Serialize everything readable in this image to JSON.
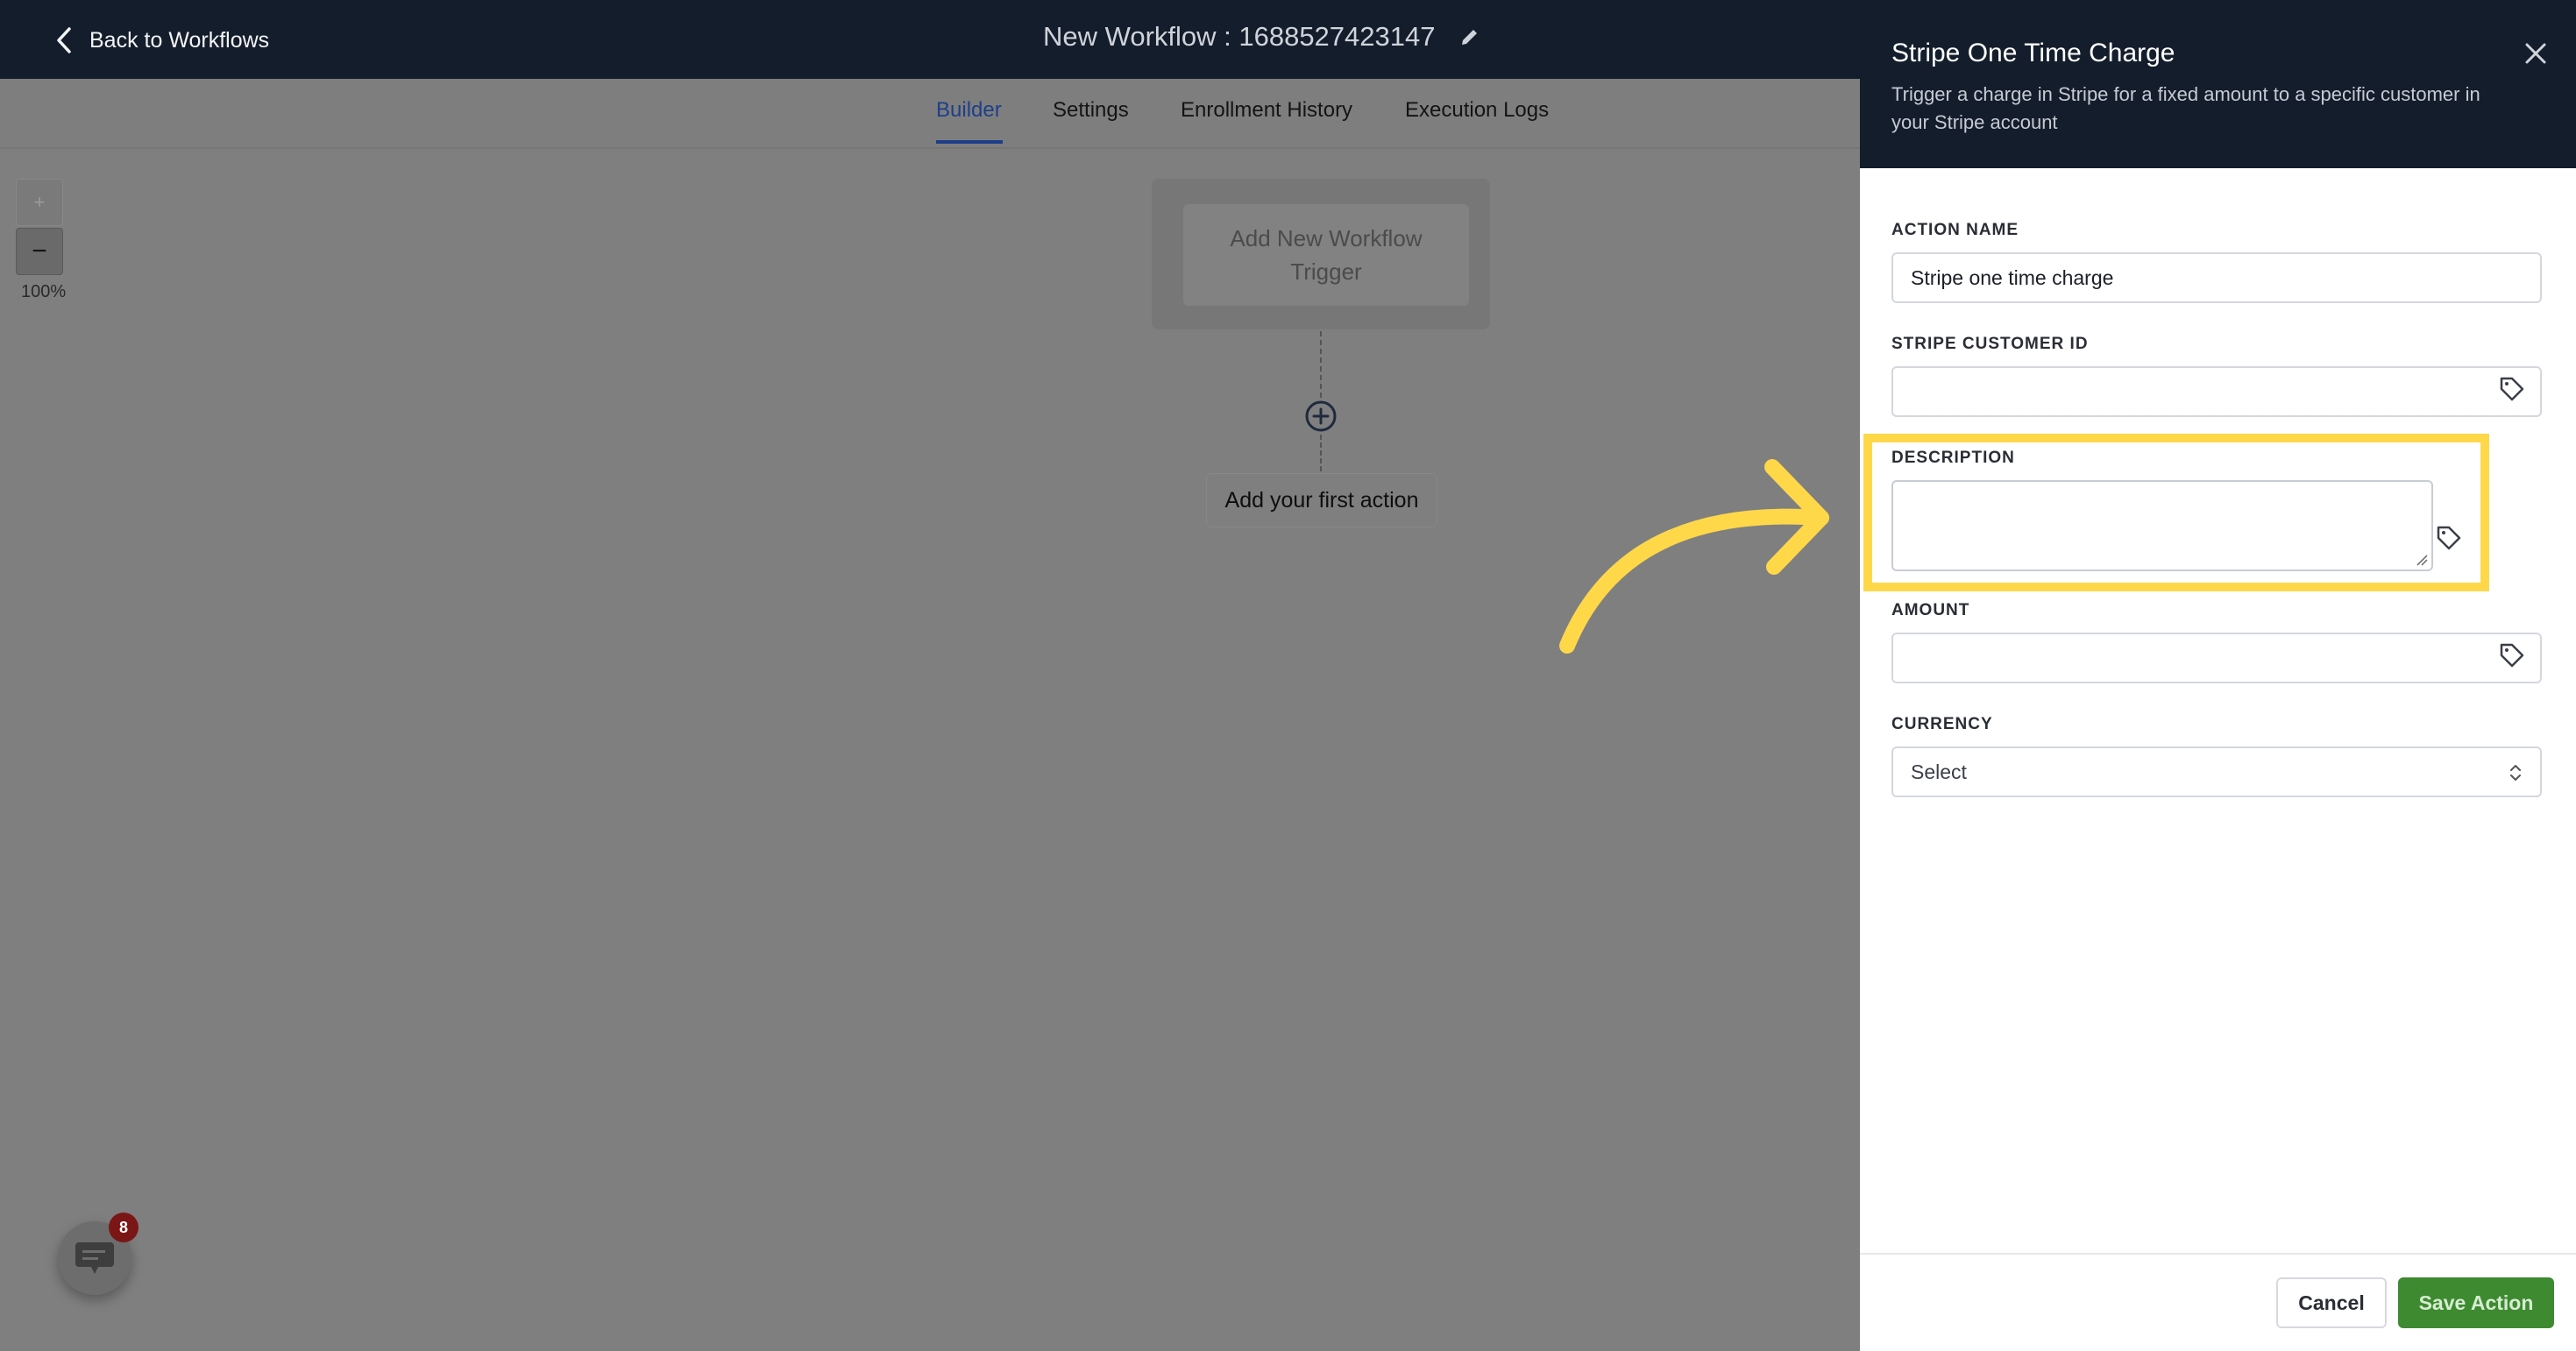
{
  "header": {
    "back_label": "Back to Workflows",
    "workflow_title": "New Workflow : 1688527423147"
  },
  "tabs": [
    {
      "label": "Builder",
      "active": true
    },
    {
      "label": "Settings",
      "active": false
    },
    {
      "label": "Enrollment History",
      "active": false
    },
    {
      "label": "Execution Logs",
      "active": false
    }
  ],
  "canvas": {
    "zoom_in": "+",
    "zoom_out": "−",
    "zoom_level": "100%",
    "trigger_line1": "Add New Workflow",
    "trigger_line2": "Trigger",
    "add_first_action": "Add your first action"
  },
  "chat": {
    "badge_count": "8"
  },
  "panel": {
    "title": "Stripe One Time Charge",
    "description": "Trigger a charge in Stripe for a fixed amount to a specific customer in your Stripe account",
    "fields": {
      "action_name_label": "ACTION NAME",
      "action_name_value": "Stripe one time charge",
      "customer_id_label": "STRIPE CUSTOMER ID",
      "customer_id_value": "",
      "description_label": "DESCRIPTION",
      "description_value": "",
      "amount_label": "AMOUNT",
      "amount_value": "",
      "currency_label": "CURRENCY",
      "currency_value": "Select"
    },
    "cancel_label": "Cancel",
    "save_label": "Save Action"
  },
  "colors": {
    "accent": "#1d3f8a",
    "highlight": "#ffd84a",
    "save_button": "#3d8a30",
    "header_bg": "#141d2b"
  },
  "icons": [
    "chevron-left-icon",
    "pencil-icon",
    "plus-circle-icon",
    "close-icon",
    "tag-icon",
    "chat-icon",
    "select-chevron-icon",
    "pointer-arrow"
  ]
}
